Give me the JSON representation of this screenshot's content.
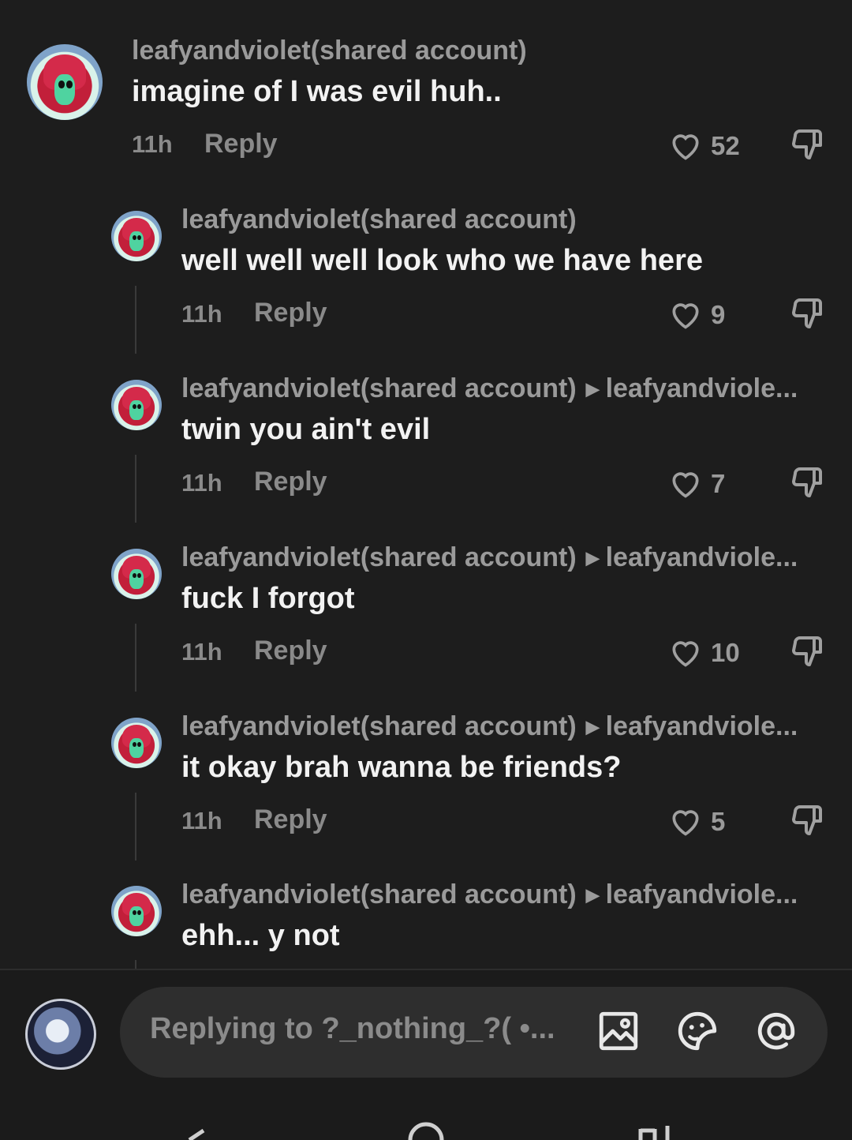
{
  "comments": [
    {
      "username": "leafyandviolet(shared account)",
      "reply_to": "",
      "text": "imagine of I was evil huh..",
      "time": "11h",
      "reply_label": "Reply",
      "likes": "52"
    },
    {
      "username": "leafyandviolet(shared account)",
      "reply_to": "",
      "text": "well well well look who we have here",
      "time": "11h",
      "reply_label": "Reply",
      "likes": "9"
    },
    {
      "username": "leafyandviolet(shared account)",
      "reply_to": "leafyandviole...",
      "text": "twin you ain't evil",
      "time": "11h",
      "reply_label": "Reply",
      "likes": "7"
    },
    {
      "username": "leafyandviolet(shared account)",
      "reply_to": "leafyandviole...",
      "text": "fuck I forgot",
      "time": "11h",
      "reply_label": "Reply",
      "likes": "10"
    },
    {
      "username": "leafyandviolet(shared account)",
      "reply_to": "leafyandviole...",
      "text": "it okay brah wanna be friends?",
      "time": "11h",
      "reply_label": "Reply",
      "likes": "5"
    },
    {
      "username": "leafyandviolet(shared account)",
      "reply_to": "leafyandviole...",
      "text": "ehh... y not",
      "time": "",
      "reply_label": "",
      "likes": ""
    }
  ],
  "composer": {
    "placeholder": "Replying to ?_nothing_?( •...",
    "icons": [
      "image-icon",
      "emoji-sticker-icon",
      "mention-icon"
    ]
  },
  "colors": {
    "background": "#1d1d1d",
    "text": "#f2f2f2",
    "muted": "#8a8a8a"
  }
}
